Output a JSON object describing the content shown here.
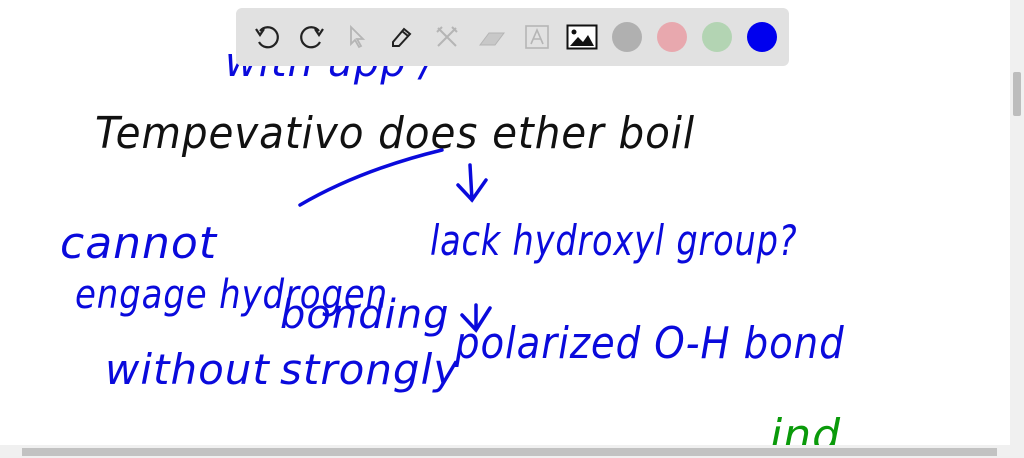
{
  "toolbar": {
    "tools": [
      "undo-icon",
      "redo-icon",
      "select-icon",
      "pen-icon",
      "tools-icon",
      "eraser-icon",
      "text-icon",
      "image-icon"
    ],
    "colors": [
      "#b0b0b0",
      "#e8a8ae",
      "#b3d4b3",
      "#0000ee"
    ],
    "selected_color": "#0000ee"
  },
  "board": {
    "top_partial": "with  upp  /",
    "line1": "Tempevativo does ether boil",
    "cannot": "cannot",
    "engage": "engage hydrogen",
    "bonding": "bonding",
    "lack": "lack hydroxyl group?",
    "without": "without",
    "strongly": "strongly",
    "polarized": "polarized O-H bond",
    "green_partial": "ind"
  }
}
